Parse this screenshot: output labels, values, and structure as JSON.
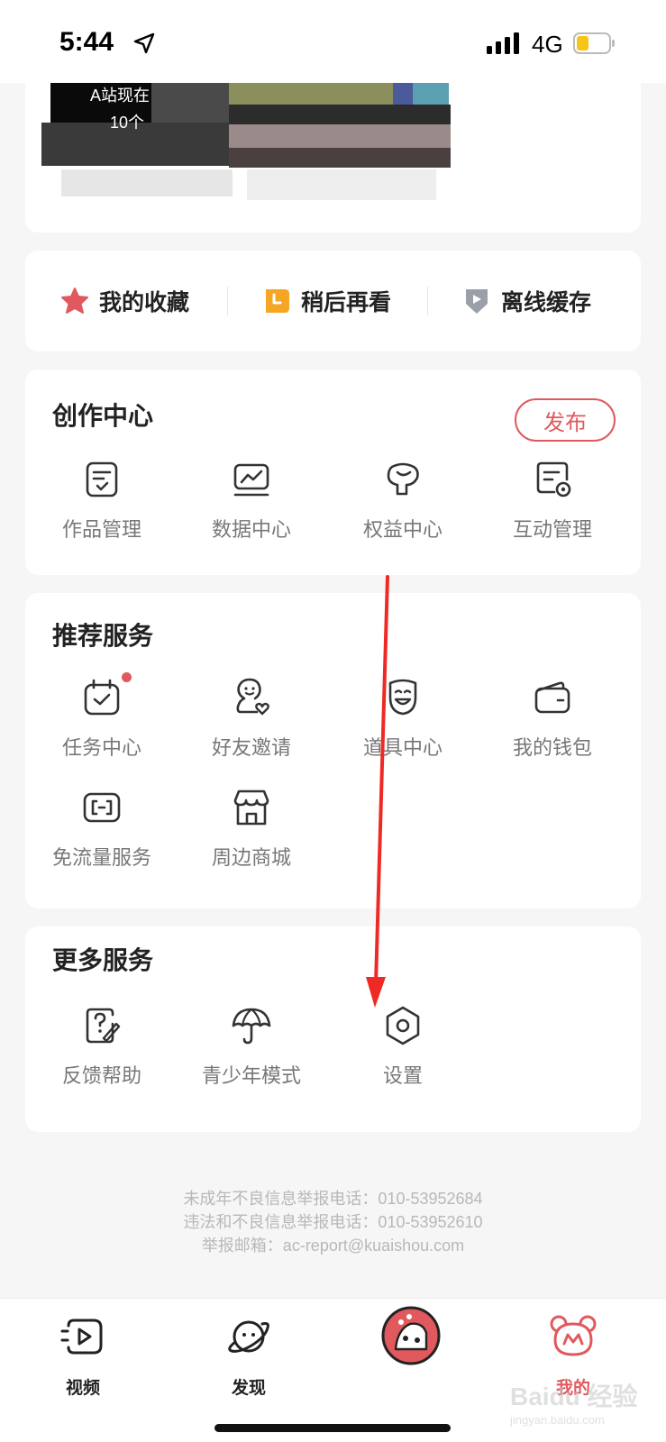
{
  "status_bar": {
    "time": "5:44",
    "network": "4G"
  },
  "banner": {
    "line1": "A站现在",
    "line2": "10个"
  },
  "quick_actions": [
    {
      "label": "我的收藏",
      "icon": "star-icon"
    },
    {
      "label": "稍后再看",
      "icon": "watch-later-icon"
    },
    {
      "label": "离线缓存",
      "icon": "offline-download-icon"
    }
  ],
  "creator_center": {
    "title": "创作中心",
    "publish_label": "发布",
    "items": [
      {
        "label": "作品管理",
        "icon": "works-management-icon"
      },
      {
        "label": "数据中心",
        "icon": "data-center-icon"
      },
      {
        "label": "权益中心",
        "icon": "rights-center-icon"
      },
      {
        "label": "互动管理",
        "icon": "interaction-management-icon"
      }
    ]
  },
  "recommended_services": {
    "title": "推荐服务",
    "items": [
      {
        "label": "任务中心",
        "icon": "task-center-icon",
        "has_badge": true
      },
      {
        "label": "好友邀请",
        "icon": "invite-friend-icon"
      },
      {
        "label": "道具中心",
        "icon": "props-center-icon"
      },
      {
        "label": "我的钱包",
        "icon": "wallet-icon"
      },
      {
        "label": "免流量服务",
        "icon": "free-data-icon"
      },
      {
        "label": "周边商城",
        "icon": "store-icon"
      }
    ]
  },
  "more_services": {
    "title": "更多服务",
    "items": [
      {
        "label": "反馈帮助",
        "icon": "feedback-help-icon"
      },
      {
        "label": "青少年模式",
        "icon": "umbrella-icon"
      },
      {
        "label": "设置",
        "icon": "settings-icon"
      }
    ]
  },
  "footer": {
    "line1": "未成年不良信息举报电话：010-53952684",
    "line2": "违法和不良信息举报电话：010-53952610",
    "line3": "举报邮箱：ac-report@kuaishou.com"
  },
  "tabbar": {
    "items": [
      {
        "label": "视频",
        "icon": "video-tab-icon",
        "active": false
      },
      {
        "label": "发现",
        "icon": "discover-tab-icon",
        "active": false
      },
      {
        "label": "",
        "icon": "center-mascot-icon",
        "active": false
      },
      {
        "label": "我的",
        "icon": "profile-tab-icon",
        "active": true
      }
    ]
  },
  "colors": {
    "accent": "#e0595e",
    "annotation_arrow": "#ee2a24",
    "background": "#f6f6f7"
  },
  "watermark": {
    "text": "Baidu 经验",
    "subtext": "jingyan.baidu.com"
  }
}
